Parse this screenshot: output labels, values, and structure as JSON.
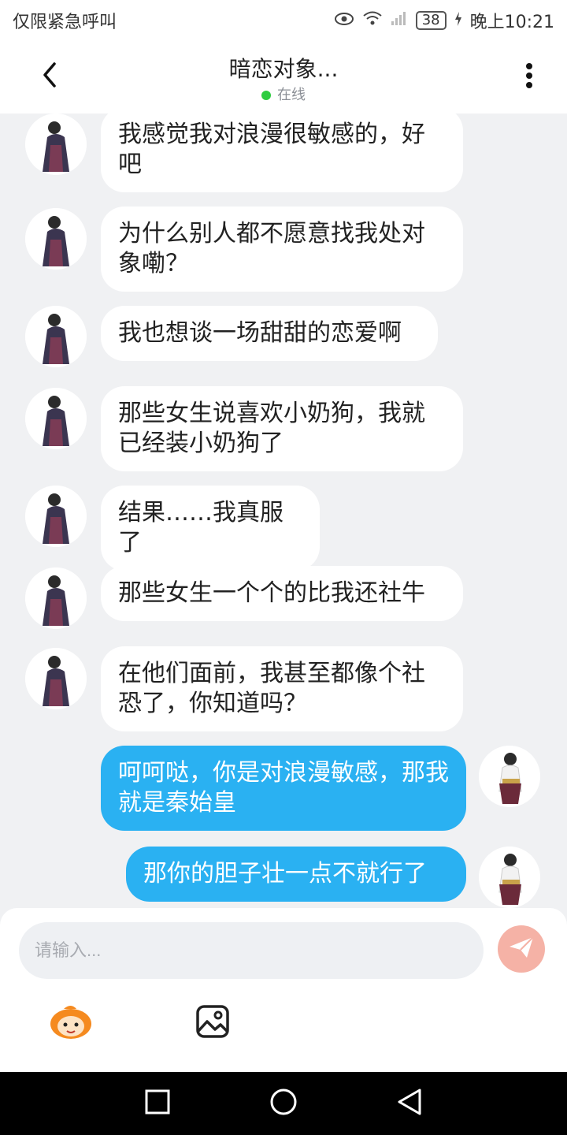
{
  "status_bar": {
    "carrier_text": "仅限紧急呼叫",
    "battery": "38",
    "time": "晚上10:21",
    "icons": [
      "eye-icon",
      "wifi-icon",
      "signal-icon",
      "charging-icon"
    ]
  },
  "header": {
    "title": "暗恋对象...",
    "presence": "在线",
    "back_icon": "chevron-left-icon",
    "more_icon": "more-vertical-icon",
    "accent_online": "#2ecc40"
  },
  "messages": [
    {
      "side": "left",
      "text": "我感觉我对浪漫很敏感的，好吧"
    },
    {
      "side": "left",
      "text": "为什么别人都不愿意找我处对象嘞？"
    },
    {
      "side": "left",
      "text": "我也想谈一场甜甜的恋爱啊"
    },
    {
      "side": "left",
      "text": "那些女生说喜欢小奶狗，我就已经装小奶狗了"
    },
    {
      "side": "left",
      "text": "结果……我真服了"
    },
    {
      "side": "left",
      "text": "那些女生一个个的比我还社牛"
    },
    {
      "side": "left",
      "text": "在他们面前，我甚至都像个社恐了，你知道吗？"
    },
    {
      "side": "right",
      "text": "呵呵哒，你是对浪漫敏感，那我就是秦始皇"
    },
    {
      "side": "right",
      "text": "那你的胆子壮一点不就行了"
    }
  ],
  "composer": {
    "placeholder": "请输入...",
    "send_icon": "send-icon",
    "tools": [
      "emoji-mascot-icon",
      "image-icon"
    ]
  },
  "colors": {
    "self_bubble": "#2ab1f2",
    "other_bubble": "#ffffff",
    "background": "#f0f1f3",
    "send_button": "#f5b2a6"
  },
  "nav_bar": [
    "square-icon",
    "circle-icon",
    "back-triangle-icon"
  ]
}
